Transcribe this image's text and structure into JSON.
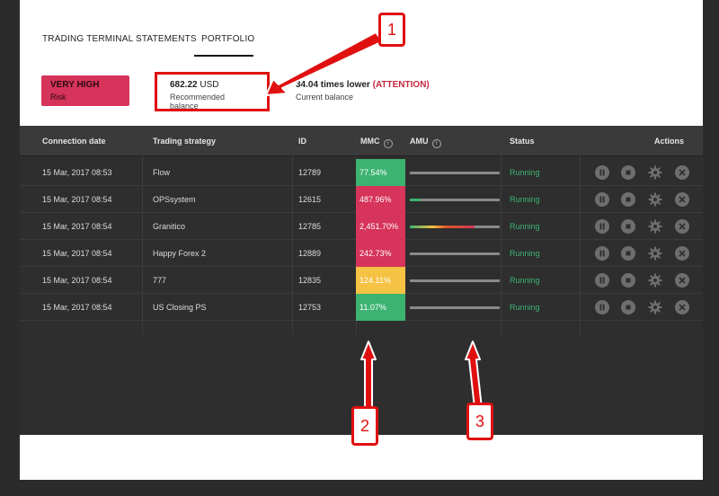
{
  "tabs": [
    {
      "label": "TRADING TERMINAL",
      "active": false
    },
    {
      "label": "STATEMENTS",
      "active": false
    },
    {
      "label": "PORTFOLIO",
      "active": true
    }
  ],
  "risk": {
    "title": "VERY HIGH",
    "subtitle": "Risk",
    "color": "#d6345a"
  },
  "balance": {
    "value": "682.22",
    "unit": " USD",
    "label": "Recommended balance"
  },
  "current": {
    "value": "34.04 times lower",
    "attention": "(ATTENTION)",
    "label": "Current balance"
  },
  "table": {
    "headers": {
      "date": "Connection date",
      "strategy": "Trading strategy",
      "id": "ID",
      "mmc": "MMC",
      "amu": "AMU",
      "status": "Status",
      "actions": "Actions"
    },
    "rows": [
      {
        "date": "15 Mar, 2017 08:53",
        "strategy": "Flow",
        "id": "12789",
        "mmc": "77.54%",
        "mmc_color": "#3cb371",
        "amu_fill": 0.0,
        "status": "Running"
      },
      {
        "date": "15 Mar, 2017 08:54",
        "strategy": "OPSsystem",
        "id": "12615",
        "mmc": "487.96%",
        "mmc_color": "#d6345a",
        "amu_fill": 0.12,
        "status": "Running"
      },
      {
        "date": "15 Mar, 2017 08:54",
        "strategy": "Granitico",
        "id": "12785",
        "mmc": "2,451.70%",
        "mmc_color": "#d6345a",
        "amu_fill": 0.72,
        "status": "Running"
      },
      {
        "date": "15 Mar, 2017 08:54",
        "strategy": "Happy Forex 2",
        "id": "12889",
        "mmc": "242.73%",
        "mmc_color": "#d6345a",
        "amu_fill": 0.0,
        "status": "Running"
      },
      {
        "date": "15 Mar, 2017 08:54",
        "strategy": "777",
        "id": "12835",
        "mmc": "124.11%",
        "mmc_color": "#f5c243",
        "amu_fill": 0.0,
        "status": "Running"
      },
      {
        "date": "15 Mar, 2017 08:54",
        "strategy": "US Closing PS",
        "id": "12753",
        "mmc": "11.07%",
        "mmc_color": "#3cb371",
        "amu_fill": 0.0,
        "status": "Running"
      }
    ]
  },
  "row_actions": [
    "pause-icon",
    "stop-icon",
    "gear-icon",
    "close-icon"
  ],
  "callouts": [
    "1",
    "2",
    "3"
  ],
  "colors": {
    "running": "#3cb371",
    "attention": "#c4283f",
    "callout": "#e01010"
  }
}
